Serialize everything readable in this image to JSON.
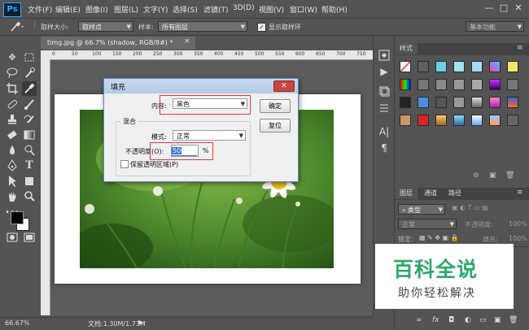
{
  "app": {
    "logo": "Ps"
  },
  "menu": [
    "文件(F)",
    "编辑(E)",
    "图像(I)",
    "图层(L)",
    "文字(Y)",
    "选择(S)",
    "滤镜(T)",
    "3D(D)",
    "视图(V)",
    "窗口(W)",
    "帮助(H)"
  ],
  "window_buttons": {
    "minimize": "—",
    "maximize": "□",
    "close": "✕"
  },
  "options_bar": {
    "sample_size_label": "取样大小:",
    "sample_size_value": "取样点",
    "sample_label": "样本:",
    "sample_value": "所有图层",
    "show_ring_label": "显示取样环",
    "workspace": "基本功能"
  },
  "document": {
    "tab_title": "timg.jpg @ 66.7% (shadow, RGB/8#) *"
  },
  "ruler_numbers": [
    "0",
    "50",
    "100",
    "150",
    "200",
    "250",
    "300",
    "350",
    "400",
    "450",
    "500",
    "550",
    "600",
    "650",
    "700",
    "750"
  ],
  "status_bar": {
    "zoom": "66.67%",
    "doc_info": "文档:1.30M/1.73M"
  },
  "styles_panel": {
    "tab": "样式"
  },
  "layers_panel": {
    "tabs": [
      "图层",
      "通道",
      "路径"
    ],
    "kind_filter": "类型",
    "blend_mode": "正常",
    "opacity_label": "不透明度:",
    "opacity_value": "100%",
    "lock_label": "锁定:",
    "fill_label": "填充:",
    "fill_value": "100%"
  },
  "fill_dialog": {
    "title": "填充",
    "contents_label": "内容:",
    "contents_value": "黑色",
    "ok": "确定",
    "reset": "复位",
    "blending_group": "混合",
    "mode_label": "模式:",
    "mode_value": "正常",
    "opacity_label": "不透明度(O):",
    "opacity_value": "50",
    "percent": "%",
    "preserve_label": "保留透明区域(P)"
  },
  "watermark": {
    "title": "百科全说",
    "subtitle": "助你轻松解决"
  },
  "colors": {
    "ui_dark": "#535353",
    "accent_blue": "#31a8ff",
    "highlight_red": "#e03a3a",
    "watermark_green": "#2fa86a"
  }
}
